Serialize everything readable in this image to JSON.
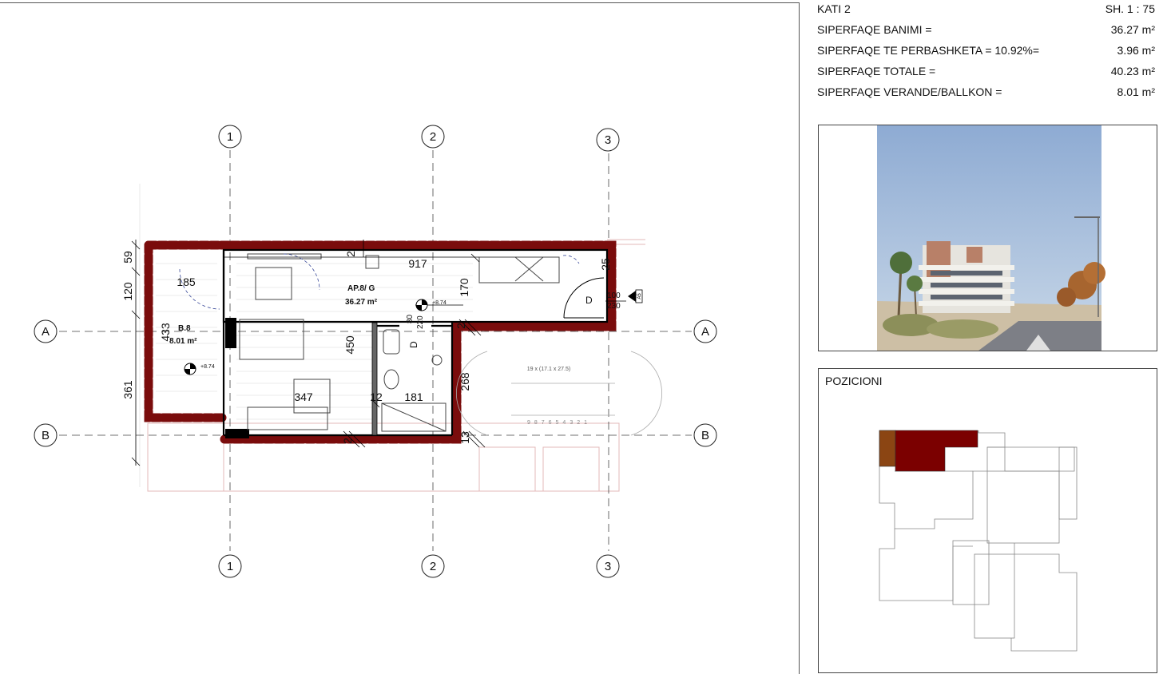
{
  "sheet": {
    "floor_label": "KATI 2",
    "scale_label": "SH. 1 : 75",
    "areas": [
      {
        "label": "SIPERFAQE BANIMI =",
        "value": "36.27 m²"
      },
      {
        "label": "SIPERFAQE TE PERBASHKETA =  10.92%=",
        "value": "3.96 m²"
      },
      {
        "label": "SIPERFAQE TOTALE =",
        "value": "40.23 m²"
      },
      {
        "label": "SIPERFAQE VERANDE/BALLKON =",
        "value": "8.01 m²"
      }
    ]
  },
  "plan": {
    "grid_columns": [
      "1",
      "2",
      "3"
    ],
    "grid_rows": [
      "A",
      "B"
    ],
    "apartment": {
      "id": "AP.8/ G",
      "area": "36.27 m²"
    },
    "balcony": {
      "id": "B.8",
      "area": "8.01 m²"
    },
    "level_mark": "+8.74",
    "stair_label": "19 x (17.1 x 27.5)",
    "stair_numbers": [
      "9",
      "8",
      "7",
      "6",
      "5",
      "4",
      "3",
      "2",
      "1"
    ],
    "door_label": "D",
    "door_dims": {
      "w": "100",
      "h": "230"
    },
    "bath_door_dims": {
      "w": "80",
      "h": "220"
    },
    "section_tag": "A5",
    "dims": {
      "d917": "917",
      "d185": "185",
      "d347": "347",
      "d181": "181",
      "d450": "450",
      "d433": "433",
      "d361": "361",
      "d120": "120",
      "d59": "59",
      "d170": "170",
      "d268": "268",
      "d12": "12",
      "d13": "13",
      "d25": "25",
      "d2a": "2",
      "d2b": "2",
      "d2c": "2"
    }
  },
  "render": {
    "sky_color": "#9cb4d6",
    "building_color": "#e8e6e0",
    "accent_color": "#b07a63"
  },
  "position": {
    "title": "POZICIONI",
    "unit_color": "#7b0000",
    "balcony_color": "#8b4513"
  },
  "colors": {
    "wall_fill": "#7a0c0c",
    "line": "#000000"
  }
}
